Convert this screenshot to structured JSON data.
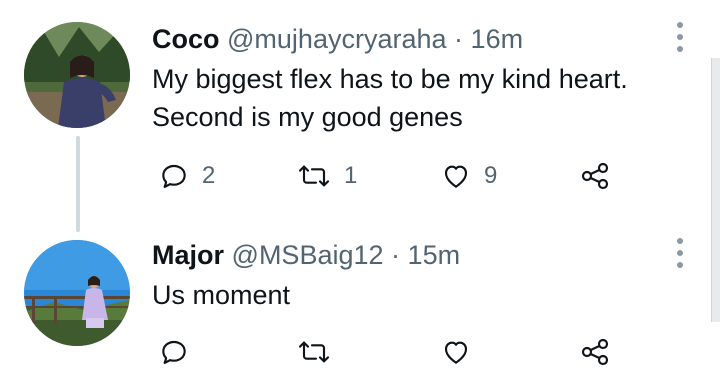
{
  "tweets": [
    {
      "name": "Coco",
      "handle": "@mujhaycryaraha",
      "separator": "·",
      "time": "16m",
      "lines": [
        "My biggest flex has to be my kind heart.",
        "Second is my good genes"
      ],
      "reply_count": "2",
      "retweet_count": "1",
      "like_count": "9"
    },
    {
      "name": "Major",
      "handle": "@MSBaig12",
      "separator": "·",
      "time": "15m",
      "lines": [
        "Us moment"
      ],
      "reply_count": "",
      "retweet_count": "",
      "like_count": ""
    }
  ],
  "icons": {
    "reply": "reply-icon",
    "retweet": "retweet-icon",
    "like": "heart-icon",
    "share": "share-icon",
    "more": "more-vertical-icon"
  },
  "colors": {
    "text": "#0f1419",
    "secondary": "#536471",
    "thread_line": "#cfd9de"
  }
}
